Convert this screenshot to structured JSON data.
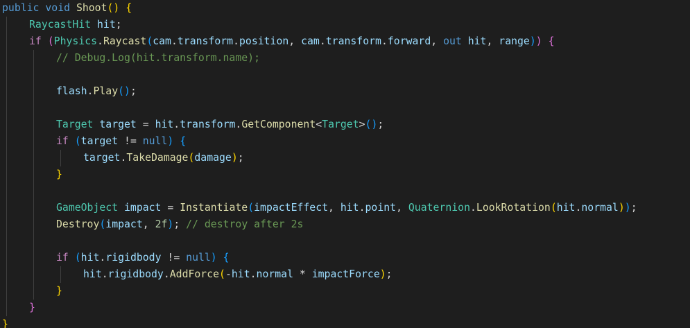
{
  "theme": {
    "background": "#1e1e1e",
    "indent_guide": "#404040",
    "colors": {
      "kw": "#569cd6",
      "ctl": "#c586c0",
      "fn": "#dcdcaa",
      "var": "#9cdcfe",
      "typ": "#4ec9b0",
      "num": "#b5cea8",
      "cmt": "#6a9955",
      "pun": "#d4d4d4",
      "b1": "#ffd700",
      "b2": "#da70d6",
      "b3": "#179fff"
    }
  },
  "code": {
    "lines": [
      {
        "indent": 0,
        "tokens": [
          {
            "t": "public",
            "c": "kw"
          },
          {
            "t": " "
          },
          {
            "t": "void",
            "c": "kw"
          },
          {
            "t": " "
          },
          {
            "t": "Shoot",
            "c": "fn"
          },
          {
            "t": "()",
            "c": "b1"
          },
          {
            "t": " "
          },
          {
            "t": "{",
            "c": "b1"
          }
        ]
      },
      {
        "indent": 1,
        "tokens": [
          {
            "t": "RaycastHit",
            "c": "typ"
          },
          {
            "t": " "
          },
          {
            "t": "hit",
            "c": "var"
          },
          {
            "t": ";",
            "c": "pun"
          }
        ]
      },
      {
        "indent": 1,
        "tokens": [
          {
            "t": "if",
            "c": "ctl"
          },
          {
            "t": " "
          },
          {
            "t": "(",
            "c": "b2"
          },
          {
            "t": "Physics",
            "c": "typ"
          },
          {
            "t": ".",
            "c": "pun"
          },
          {
            "t": "Raycast",
            "c": "fn"
          },
          {
            "t": "(",
            "c": "b3"
          },
          {
            "t": "cam",
            "c": "var"
          },
          {
            "t": ".",
            "c": "pun"
          },
          {
            "t": "transform",
            "c": "var"
          },
          {
            "t": ".",
            "c": "pun"
          },
          {
            "t": "position",
            "c": "var"
          },
          {
            "t": ", ",
            "c": "pun"
          },
          {
            "t": "cam",
            "c": "var"
          },
          {
            "t": ".",
            "c": "pun"
          },
          {
            "t": "transform",
            "c": "var"
          },
          {
            "t": ".",
            "c": "pun"
          },
          {
            "t": "forward",
            "c": "var"
          },
          {
            "t": ", ",
            "c": "pun"
          },
          {
            "t": "out",
            "c": "kw"
          },
          {
            "t": " "
          },
          {
            "t": "hit",
            "c": "var"
          },
          {
            "t": ", ",
            "c": "pun"
          },
          {
            "t": "range",
            "c": "var"
          },
          {
            "t": ")",
            "c": "b3"
          },
          {
            "t": ")",
            "c": "b2"
          },
          {
            "t": " "
          },
          {
            "t": "{",
            "c": "b2"
          }
        ]
      },
      {
        "indent": 2,
        "tokens": [
          {
            "t": "// Debug.Log(hit.transform.name);",
            "c": "cmt"
          }
        ]
      },
      {
        "indent": 2,
        "tokens": []
      },
      {
        "indent": 2,
        "tokens": [
          {
            "t": "flash",
            "c": "var"
          },
          {
            "t": ".",
            "c": "pun"
          },
          {
            "t": "Play",
            "c": "fn"
          },
          {
            "t": "()",
            "c": "b3"
          },
          {
            "t": ";",
            "c": "pun"
          }
        ]
      },
      {
        "indent": 2,
        "tokens": []
      },
      {
        "indent": 2,
        "tokens": [
          {
            "t": "Target",
            "c": "typ"
          },
          {
            "t": " "
          },
          {
            "t": "target",
            "c": "var"
          },
          {
            "t": " = ",
            "c": "pun"
          },
          {
            "t": "hit",
            "c": "var"
          },
          {
            "t": ".",
            "c": "pun"
          },
          {
            "t": "transform",
            "c": "var"
          },
          {
            "t": ".",
            "c": "pun"
          },
          {
            "t": "GetComponent",
            "c": "fn"
          },
          {
            "t": "<",
            "c": "pun"
          },
          {
            "t": "Target",
            "c": "typ"
          },
          {
            "t": ">",
            "c": "pun"
          },
          {
            "t": "()",
            "c": "b3"
          },
          {
            "t": ";",
            "c": "pun"
          }
        ]
      },
      {
        "indent": 2,
        "tokens": [
          {
            "t": "if",
            "c": "ctl"
          },
          {
            "t": " "
          },
          {
            "t": "(",
            "c": "b3"
          },
          {
            "t": "target",
            "c": "var"
          },
          {
            "t": " != ",
            "c": "pun"
          },
          {
            "t": "null",
            "c": "kw"
          },
          {
            "t": ")",
            "c": "b3"
          },
          {
            "t": " "
          },
          {
            "t": "{",
            "c": "b3"
          }
        ]
      },
      {
        "indent": 3,
        "tokens": [
          {
            "t": "target",
            "c": "var"
          },
          {
            "t": ".",
            "c": "pun"
          },
          {
            "t": "TakeDamage",
            "c": "fn"
          },
          {
            "t": "(",
            "c": "b1"
          },
          {
            "t": "damage",
            "c": "var"
          },
          {
            "t": ")",
            "c": "b1"
          },
          {
            "t": ";",
            "c": "pun"
          }
        ]
      },
      {
        "indent": 2,
        "tokens": [
          {
            "t": "}",
            "c": "b1"
          }
        ]
      },
      {
        "indent": 2,
        "tokens": []
      },
      {
        "indent": 2,
        "tokens": [
          {
            "t": "GameObject",
            "c": "typ"
          },
          {
            "t": " "
          },
          {
            "t": "impact",
            "c": "var"
          },
          {
            "t": " = ",
            "c": "pun"
          },
          {
            "t": "Instantiate",
            "c": "fn"
          },
          {
            "t": "(",
            "c": "b3"
          },
          {
            "t": "impactEffect",
            "c": "var"
          },
          {
            "t": ", ",
            "c": "pun"
          },
          {
            "t": "hit",
            "c": "var"
          },
          {
            "t": ".",
            "c": "pun"
          },
          {
            "t": "point",
            "c": "var"
          },
          {
            "t": ", ",
            "c": "pun"
          },
          {
            "t": "Quaternion",
            "c": "typ"
          },
          {
            "t": ".",
            "c": "pun"
          },
          {
            "t": "LookRotation",
            "c": "fn"
          },
          {
            "t": "(",
            "c": "b1"
          },
          {
            "t": "hit",
            "c": "var"
          },
          {
            "t": ".",
            "c": "pun"
          },
          {
            "t": "normal",
            "c": "var"
          },
          {
            "t": ")",
            "c": "b1"
          },
          {
            "t": ")",
            "c": "b3"
          },
          {
            "t": ";",
            "c": "pun"
          }
        ]
      },
      {
        "indent": 2,
        "tokens": [
          {
            "t": "Destroy",
            "c": "fn"
          },
          {
            "t": "(",
            "c": "b3"
          },
          {
            "t": "impact",
            "c": "var"
          },
          {
            "t": ", ",
            "c": "pun"
          },
          {
            "t": "2f",
            "c": "num"
          },
          {
            "t": ")",
            "c": "b3"
          },
          {
            "t": ";",
            "c": "pun"
          },
          {
            "t": " "
          },
          {
            "t": "// destroy after 2s",
            "c": "cmt"
          }
        ]
      },
      {
        "indent": 2,
        "tokens": []
      },
      {
        "indent": 2,
        "tokens": [
          {
            "t": "if",
            "c": "ctl"
          },
          {
            "t": " "
          },
          {
            "t": "(",
            "c": "b3"
          },
          {
            "t": "hit",
            "c": "var"
          },
          {
            "t": ".",
            "c": "pun"
          },
          {
            "t": "rigidbody",
            "c": "var"
          },
          {
            "t": " != ",
            "c": "pun"
          },
          {
            "t": "null",
            "c": "kw"
          },
          {
            "t": ")",
            "c": "b3"
          },
          {
            "t": " "
          },
          {
            "t": "{",
            "c": "b3"
          }
        ]
      },
      {
        "indent": 3,
        "tokens": [
          {
            "t": "hit",
            "c": "var"
          },
          {
            "t": ".",
            "c": "pun"
          },
          {
            "t": "rigidbody",
            "c": "var"
          },
          {
            "t": ".",
            "c": "pun"
          },
          {
            "t": "AddForce",
            "c": "fn"
          },
          {
            "t": "(",
            "c": "b1"
          },
          {
            "t": "-",
            "c": "pun"
          },
          {
            "t": "hit",
            "c": "var"
          },
          {
            "t": ".",
            "c": "pun"
          },
          {
            "t": "normal",
            "c": "var"
          },
          {
            "t": " * ",
            "c": "pun"
          },
          {
            "t": "impactForce",
            "c": "var"
          },
          {
            "t": ")",
            "c": "b1"
          },
          {
            "t": ";",
            "c": "pun"
          }
        ]
      },
      {
        "indent": 2,
        "tokens": [
          {
            "t": "}",
            "c": "b1"
          }
        ]
      },
      {
        "indent": 1,
        "tokens": [
          {
            "t": "}",
            "c": "b2"
          }
        ]
      },
      {
        "indent": 0,
        "tokens": [
          {
            "t": "}",
            "c": "b1"
          }
        ]
      }
    ]
  }
}
